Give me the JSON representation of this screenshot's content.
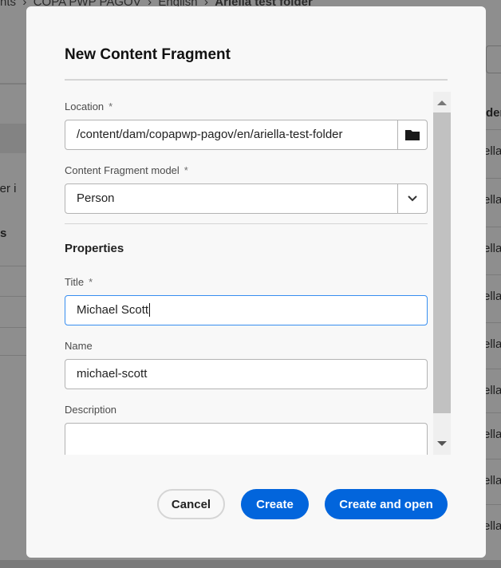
{
  "background": {
    "breadcrumb": [
      "nts",
      "COPA PWP PAGOV",
      "English",
      "Ariella test folder"
    ],
    "left_text": [
      "lder i",
      "s"
    ],
    "column_header": "der",
    "row_values": [
      "ella",
      "ella",
      "ella",
      "ella",
      "ella",
      "ella",
      "ella",
      "ella",
      "ella"
    ]
  },
  "dialog": {
    "title": "New Content Fragment",
    "location": {
      "label": "Location",
      "required": "*",
      "value": "/content/dam/copapwp-pagov/en/ariella-test-folder",
      "icon": "folder-icon"
    },
    "model": {
      "label": "Content Fragment model",
      "required": "*",
      "value": "Person",
      "icon": "chevron-down-icon"
    },
    "properties_heading": "Properties",
    "title_field": {
      "label": "Title",
      "required": "*",
      "value": "Michael Scott"
    },
    "name_field": {
      "label": "Name",
      "value": "michael-scott"
    },
    "description_field": {
      "label": "Description",
      "value": ""
    },
    "buttons": {
      "cancel": "Cancel",
      "create": "Create",
      "create_open": "Create and open"
    },
    "colors": {
      "accent": "#0265dc",
      "focus": "#378ef0"
    }
  }
}
